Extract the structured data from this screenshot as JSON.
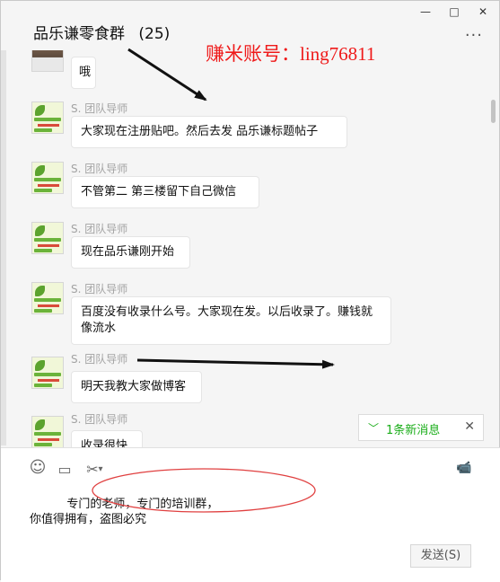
{
  "window": {
    "title": "品乐谦零食群",
    "member_count": "(25)",
    "controls": [
      "—",
      "□",
      "✕"
    ],
    "more_label": "···"
  },
  "watermark": "赚米账号：ling76811",
  "messages": [
    {
      "sender": "",
      "text": "哦",
      "avatar": "photo"
    },
    {
      "sender": "S. 团队导师",
      "text": "大家现在注册贴吧。然后去发 品乐谦标题帖子",
      "avatar": "logo"
    },
    {
      "sender": "S. 团队导师",
      "text": "不管第二 第三楼留下自己微信",
      "avatar": "logo"
    },
    {
      "sender": "S. 团队导师",
      "text": "现在品乐谦刚开始",
      "avatar": "logo"
    },
    {
      "sender": "S. 团队导师",
      "text": "百度没有收录什么号。大家现在发。以后收录了。赚钱就像流水",
      "avatar": "logo"
    },
    {
      "sender": "S. 团队导师",
      "text": "明天我教大家做博客",
      "avatar": "logo"
    },
    {
      "sender": "S. 团队导师",
      "text": "收录很快",
      "avatar": "logo"
    }
  ],
  "new_message": {
    "chevron": "﹀",
    "text": "1条新消息",
    "close": "✕"
  },
  "toolbar": {
    "emoji_icon": "☺",
    "folder_icon": "▭",
    "scissors_icon": "✂",
    "dropdown_icon": "▾",
    "video_icon": "📹"
  },
  "input": {
    "text": "          专门的老师，专门的培训群，\n你值得拥有，盗图必究"
  },
  "send_label": "发送(S)",
  "colors": {
    "watermark": "#ef1a1a",
    "annotation": "#e04040",
    "accent": "#1aad19"
  }
}
